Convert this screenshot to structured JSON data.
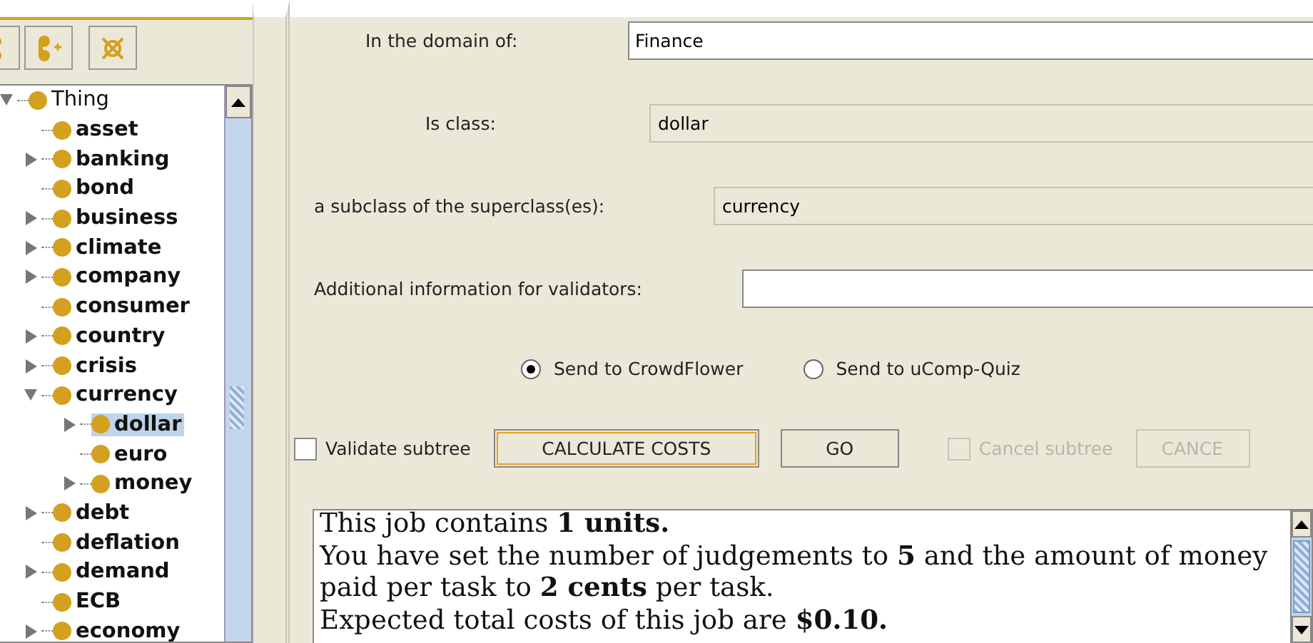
{
  "tree": {
    "items": [
      {
        "label": "Thing",
        "expanded": true,
        "selected": false,
        "children": [
          {
            "label": "asset",
            "selected": false
          },
          {
            "label": "banking",
            "expanded": false,
            "selected": false
          },
          {
            "label": "bond",
            "selected": false
          },
          {
            "label": "business",
            "expanded": false,
            "selected": false
          },
          {
            "label": "climate",
            "expanded": false,
            "selected": false
          },
          {
            "label": "company",
            "expanded": false,
            "selected": false
          },
          {
            "label": "consumer",
            "selected": false
          },
          {
            "label": "country",
            "expanded": false,
            "selected": false
          },
          {
            "label": "crisis",
            "expanded": false,
            "selected": false
          },
          {
            "label": "currency",
            "expanded": true,
            "selected": false,
            "children": [
              {
                "label": "dollar",
                "expanded": false,
                "selected": true
              },
              {
                "label": "euro",
                "selected": false
              },
              {
                "label": "money",
                "expanded": false,
                "selected": false
              }
            ]
          },
          {
            "label": "debt",
            "expanded": false,
            "selected": false
          },
          {
            "label": "deflation",
            "selected": false
          },
          {
            "label": "demand",
            "expanded": false,
            "selected": false
          },
          {
            "label": "ECB",
            "selected": false
          },
          {
            "label": "economy",
            "expanded": false,
            "selected": false
          }
        ]
      }
    ]
  },
  "form": {
    "domain": {
      "label": "In the domain of:",
      "value": "Finance"
    },
    "is_class": {
      "label": "Is class:",
      "value": "dollar"
    },
    "superclass": {
      "label": "a subclass of the superclass(es):",
      "value": "currency"
    },
    "additional": {
      "label": "Additional information for validators:"
    }
  },
  "targets": [
    {
      "label": "Send to CrowdFlower",
      "selected": true
    },
    {
      "label": "Send to uComp-Quiz",
      "selected": false
    }
  ],
  "validate_subtree": {
    "label": "Validate subtree",
    "checked": false
  },
  "calculate_button": {
    "label": "CALCULATE COSTS",
    "focused": true
  },
  "go_button": {
    "label": "GO"
  },
  "cancel_subtree": {
    "label": "Cancel subtree",
    "checked": false,
    "disabled": true
  },
  "cancel_button": {
    "label": "CANCE",
    "disabled": true
  },
  "summary": [
    "This job contains **1 units.**",
    "You have set the number of judgements to **5** and the amount of money",
    "paid per task to **2 cents** per task.",
    "Expected total costs of this job are **$0.10.**"
  ]
}
